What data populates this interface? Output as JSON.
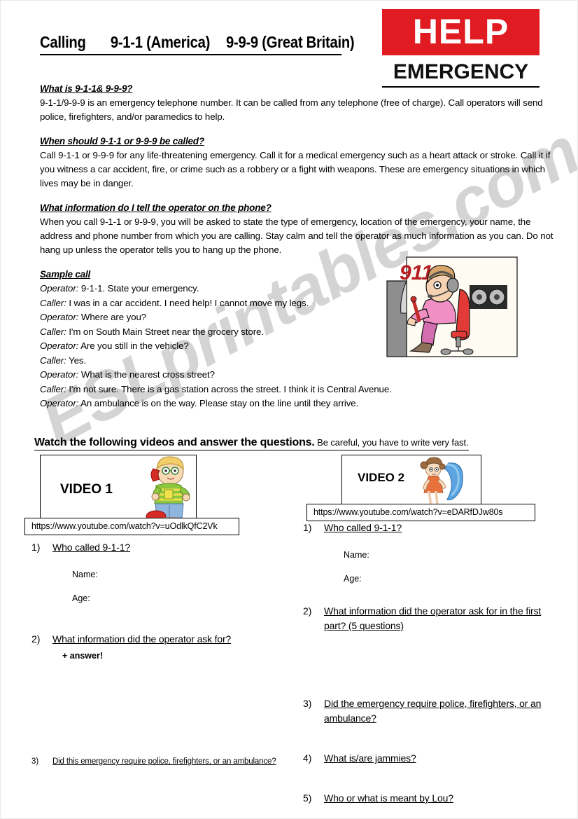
{
  "header": {
    "title_part1": "Calling",
    "title_part2": "9-1-1 (America)",
    "title_part3": "9-9-9 (Great Britain)",
    "logo_help": "HELP",
    "logo_emergency": "EMERGENCY",
    "logo_red": "#e01b22"
  },
  "sections": [
    {
      "heading": "What is 9-1-1& 9-9-9?",
      "body": "9-1-1/9-9-9 is an emergency telephone number.  It can be called from any telephone (free of charge).  Call operators will send police, firefighters, and/or paramedics to help."
    },
    {
      "heading": "When should 9-1-1 or 9-9-9 be called?",
      "body": " Call 9-1-1 or 9-9-9 for any life-threatening emergency.  Call it for a medical emergency such as a heart attack or stroke.  Call it if you witness a car accident, fire, or crime such as a robbery or a fight with weapons.  These are emergency situations in which lives may be in danger."
    },
    {
      "heading": "What information do I tell the operator on the phone?",
      "body": "When you call 9-1-1 or 9-9-9, you will be asked to state the type of emergency, location of the emergency, your name, the address and phone number from which you are calling.  Stay calm and tell the operator as much information as you can.  Do not hang up unless the operator tells you to hang up the phone."
    }
  ],
  "sample_call": {
    "heading": "Sample call",
    "lines": [
      {
        "speaker": "Operator:",
        "text": " 9-1-1. State your emergency."
      },
      {
        "speaker": "Caller:",
        "text": "  I was in a car accident.  I need help! I cannot move my legs."
      },
      {
        "speaker": "Operator:",
        "text": " Where are you?"
      },
      {
        "speaker": "Caller:",
        "text": " I'm on South Main Street near the grocery store."
      },
      {
        "speaker": "Operator:",
        "text": " Are you still in the vehicle?"
      },
      {
        "speaker": "Caller:",
        "text": " Yes."
      },
      {
        "speaker": "Operator:",
        "text": " What is the nearest cross street?"
      },
      {
        "speaker": "Caller:",
        "text": " I'm not sure.  There is a gas station across the street.  I think it is Central  Avenue."
      },
      {
        "speaker": "Operator:",
        "text": "  An ambulance is on the way.  Please stay on the line until they arrive."
      }
    ]
  },
  "videos_section": {
    "instruction_bold": "Watch the following videos and answer the questions.",
    "instruction_rest": " Be careful, you have to write very fast.",
    "video1": {
      "label": "VIDEO 1",
      "url": "https://www.youtube.com/watch?v=uOdlkQfC2Vk",
      "clipart": "boy-on-telephone-clipart"
    },
    "video2": {
      "label": "VIDEO 2",
      "url": "https://www.youtube.com/watch?v=eDARfDJw80s",
      "clipart": "girl-on-telephone-clipart"
    }
  },
  "left_questions": [
    {
      "num": "1)",
      "text": "Who called 9-1-1?",
      "sub": [
        "Name:",
        "Age:"
      ]
    },
    {
      "num": "2)",
      "text": "What information did the operator ask for?",
      "note": "+ answer!"
    },
    {
      "num": "3)",
      "text": "Did this emergency require police, firefighters, or an ambulance?"
    }
  ],
  "right_questions": [
    {
      "num": "1)",
      "text": "Who called 9-1-1?",
      "sub": [
        "Name:",
        "Age:"
      ]
    },
    {
      "num": "2)",
      "text": "What information did the operator ask for in the first part? (5 questions)"
    },
    {
      "num": "3)",
      "text": "Did the emergency require police, firefighters, or an ambulance?"
    },
    {
      "num": "4)",
      "text": "What is/are jammies?"
    },
    {
      "num": "5)",
      "text": "Who or what is meant by Lou?"
    }
  ],
  "clipart": {
    "operator": "911-operator-clipart",
    "operator_caption": "911"
  },
  "watermark": "ESLprintables.com"
}
